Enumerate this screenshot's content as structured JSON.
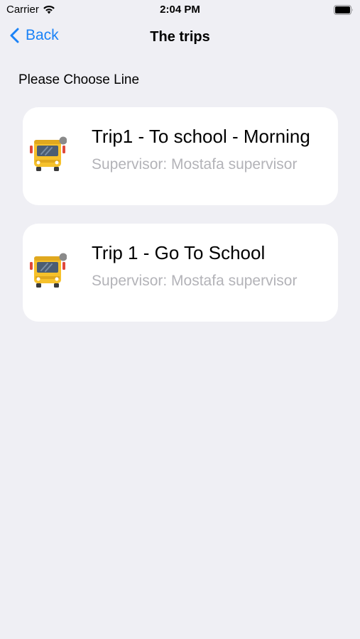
{
  "status_bar": {
    "carrier": "Carrier",
    "time": "2:04 PM",
    "wifi_icon": "wifi-icon",
    "battery_icon": "battery-icon"
  },
  "nav": {
    "back_label": "Back",
    "back_icon": "chevron-left-icon",
    "title": "The trips"
  },
  "section_label": "Please Choose Line",
  "trips": [
    {
      "title": "Trip1 - To school - Morning",
      "supervisor": "Supervisor: Mostafa supervisor",
      "icon": "school-bus-icon"
    },
    {
      "title": "Trip 1 - Go To School",
      "supervisor": "Supervisor: Mostafa supervisor",
      "icon": "school-bus-icon"
    }
  ],
  "colors": {
    "accent": "#1a82f7",
    "background": "#efeff4",
    "card": "#ffffff",
    "secondary_text": "#b3b3b8",
    "bus_yellow": "#f6c12b"
  }
}
